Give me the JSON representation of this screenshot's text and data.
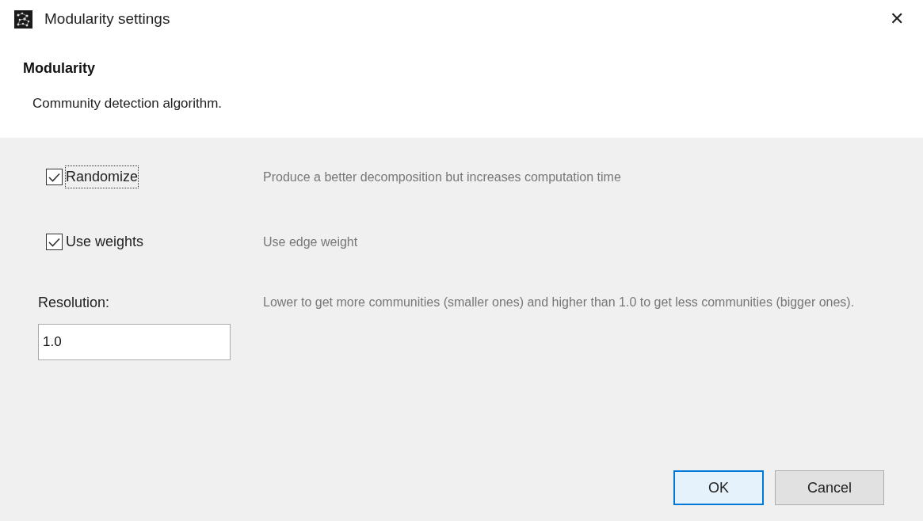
{
  "window": {
    "title": "Modularity settings",
    "close": "✕"
  },
  "header": {
    "title": "Modularity",
    "subtitle": "Community detection algorithm."
  },
  "options": [
    {
      "kind": "checkbox",
      "label": "Randomize",
      "checked": true,
      "focused": true,
      "description": "Produce a better decomposition but increases computation time"
    },
    {
      "kind": "checkbox",
      "label": "Use weights",
      "checked": true,
      "focused": false,
      "description": "Use edge weight"
    },
    {
      "kind": "number",
      "label": "Resolution:",
      "value": "1.0",
      "description": "Lower to get more communities (smaller ones) and higher than 1.0 to get less communities (bigger ones)."
    }
  ],
  "buttons": [
    {
      "label": "OK",
      "default": true
    },
    {
      "label": "Cancel",
      "default": false
    }
  ]
}
